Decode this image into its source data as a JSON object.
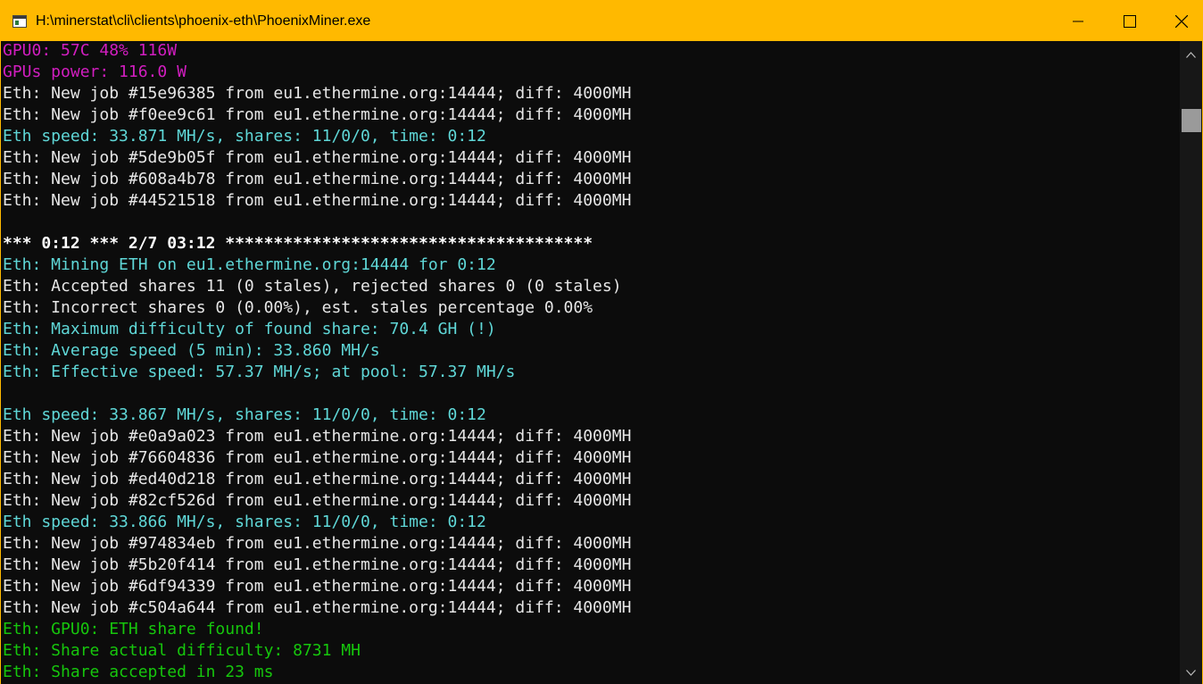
{
  "window": {
    "title": "H:\\minerstat\\cli\\clients\\phoenix-eth\\PhoenixMiner.exe",
    "accent_color": "#ffb900"
  },
  "icons": {
    "app": "console-window-icon",
    "minimize": "minimize-icon",
    "maximize": "maximize-icon",
    "close": "close-icon",
    "scroll_up": "chevron-up-icon",
    "scroll_down": "chevron-down-icon"
  },
  "colors": {
    "white": "#e6e6e6",
    "magenta": "#d21ec0",
    "cyan": "#5fd7d7",
    "green": "#16c60c",
    "bright": "#ffffff"
  },
  "console": {
    "lines": [
      {
        "text": "GPU0: 57C 48% 116W",
        "color": "magenta"
      },
      {
        "text": "GPUs power: 116.0 W",
        "color": "magenta"
      },
      {
        "text": "Eth: New job #15e96385 from eu1.ethermine.org:14444; diff: 4000MH",
        "color": "white"
      },
      {
        "text": "Eth: New job #f0ee9c61 from eu1.ethermine.org:14444; diff: 4000MH",
        "color": "white"
      },
      {
        "text": "Eth speed: 33.871 MH/s, shares: 11/0/0, time: 0:12",
        "color": "cyan"
      },
      {
        "text": "Eth: New job #5de9b05f from eu1.ethermine.org:14444; diff: 4000MH",
        "color": "white"
      },
      {
        "text": "Eth: New job #608a4b78 from eu1.ethermine.org:14444; diff: 4000MH",
        "color": "white"
      },
      {
        "text": "Eth: New job #44521518 from eu1.ethermine.org:14444; diff: 4000MH",
        "color": "white"
      },
      {
        "text": "",
        "color": "white"
      },
      {
        "text": "*** 0:12 *** 2/7 03:12 **************************************",
        "color": "bright"
      },
      {
        "text": "Eth: Mining ETH on eu1.ethermine.org:14444 for 0:12",
        "color": "cyan"
      },
      {
        "text": "Eth: Accepted shares 11 (0 stales), rejected shares 0 (0 stales)",
        "color": "white"
      },
      {
        "text": "Eth: Incorrect shares 0 (0.00%), est. stales percentage 0.00%",
        "color": "white"
      },
      {
        "text": "Eth: Maximum difficulty of found share: 70.4 GH (!)",
        "color": "cyan"
      },
      {
        "text": "Eth: Average speed (5 min): 33.860 MH/s",
        "color": "cyan"
      },
      {
        "text": "Eth: Effective speed: 57.37 MH/s; at pool: 57.37 MH/s",
        "color": "cyan"
      },
      {
        "text": "",
        "color": "white"
      },
      {
        "text": "Eth speed: 33.867 MH/s, shares: 11/0/0, time: 0:12",
        "color": "cyan"
      },
      {
        "text": "Eth: New job #e0a9a023 from eu1.ethermine.org:14444; diff: 4000MH",
        "color": "white"
      },
      {
        "text": "Eth: New job #76604836 from eu1.ethermine.org:14444; diff: 4000MH",
        "color": "white"
      },
      {
        "text": "Eth: New job #ed40d218 from eu1.ethermine.org:14444; diff: 4000MH",
        "color": "white"
      },
      {
        "text": "Eth: New job #82cf526d from eu1.ethermine.org:14444; diff: 4000MH",
        "color": "white"
      },
      {
        "text": "Eth speed: 33.866 MH/s, shares: 11/0/0, time: 0:12",
        "color": "cyan"
      },
      {
        "text": "Eth: New job #974834eb from eu1.ethermine.org:14444; diff: 4000MH",
        "color": "white"
      },
      {
        "text": "Eth: New job #5b20f414 from eu1.ethermine.org:14444; diff: 4000MH",
        "color": "white"
      },
      {
        "text": "Eth: New job #6df94339 from eu1.ethermine.org:14444; diff: 4000MH",
        "color": "white"
      },
      {
        "text": "Eth: New job #c504a644 from eu1.ethermine.org:14444; diff: 4000MH",
        "color": "white"
      },
      {
        "text": "Eth: GPU0: ETH share found!",
        "color": "green"
      },
      {
        "text": "Eth: Share actual difficulty: 8731 MH",
        "color": "green"
      },
      {
        "text": "Eth: Share accepted in 23 ms",
        "color": "green"
      }
    ]
  }
}
